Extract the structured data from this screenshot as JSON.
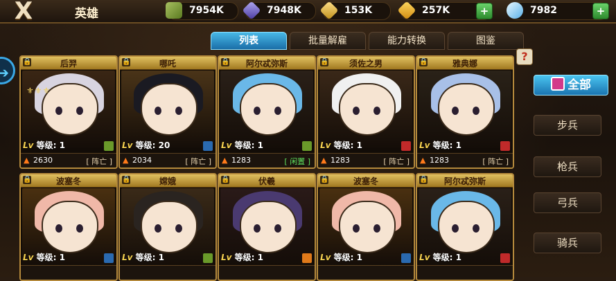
{
  "header": {
    "close_label": "X",
    "title": "英雄",
    "resources": [
      {
        "name": "wood",
        "value": "7954K",
        "icon": "wood-icon",
        "color": "#7a9a3a"
      },
      {
        "name": "stone",
        "value": "7948K",
        "icon": "crystal-icon",
        "color": "#6a5ac0"
      },
      {
        "name": "gold-ore",
        "value": "153K",
        "icon": "gold-ore-icon",
        "color": "#e0b83a"
      },
      {
        "name": "gold",
        "value": "257K",
        "icon": "gold-icon",
        "color": "#f0b820"
      },
      {
        "name": "diamond",
        "value": "7982",
        "icon": "diamond-icon",
        "color": "#9ad8ff"
      }
    ]
  },
  "tabs": [
    {
      "label": "列表",
      "active": true
    },
    {
      "label": "批量解雇",
      "active": false
    },
    {
      "label": "能力转换",
      "active": false
    },
    {
      "label": "图鉴",
      "active": false
    }
  ],
  "help_label": "?",
  "heroes": [
    {
      "name": "后羿",
      "level": "1",
      "power": "2630",
      "status": "阵亡",
      "hair": "#d8d4e0",
      "bg": "#3a2614",
      "badge": "#6a9a2a",
      "stars": "⚜⚜⚜"
    },
    {
      "name": "哪吒",
      "level": "20",
      "power": "2034",
      "status": "阵亡",
      "hair": "#1a1a22",
      "bg": "#4a3418",
      "badge": "#2a6ab0",
      "stars": ""
    },
    {
      "name": "阿尔忒弥斯",
      "level": "1",
      "power": "1283",
      "status": "闲置",
      "hair": "#6ab8e8",
      "bg": "#2a2018",
      "badge": "#6a9a2a",
      "stars": ""
    },
    {
      "name": "须佐之男",
      "level": "1",
      "power": "1283",
      "status": "阵亡",
      "hair": "#f0f0f0",
      "bg": "#3a2818",
      "badge": "#c02a2a",
      "stars": ""
    },
    {
      "name": "雅典娜",
      "level": "1",
      "power": "1283",
      "status": "阵亡",
      "hair": "#a8c0e8",
      "bg": "#2a2218",
      "badge": "#c02a2a",
      "stars": ""
    },
    {
      "name": "波塞冬",
      "level": "1",
      "power": "",
      "status": "",
      "hair": "#f0b8a8",
      "bg": "#4a3010",
      "badge": "#2a6ab0",
      "stars": ""
    },
    {
      "name": "嫦娥",
      "level": "1",
      "power": "",
      "status": "",
      "hair": "#2a2420",
      "bg": "#3a2a18",
      "badge": "#6a9a2a",
      "stars": ""
    },
    {
      "name": "伏羲",
      "level": "1",
      "power": "",
      "status": "",
      "hair": "#4a3a70",
      "bg": "#2a1a18",
      "badge": "#e07a1a",
      "stars": ""
    },
    {
      "name": "波塞冬",
      "level": "1",
      "power": "",
      "status": "",
      "hair": "#f0b8a8",
      "bg": "#4a3010",
      "badge": "#2a6ab0",
      "stars": ""
    },
    {
      "name": "阿尔忒弥斯",
      "level": "1",
      "power": "",
      "status": "",
      "hair": "#6ab8e8",
      "bg": "#2a2018",
      "badge": "#c02a2a",
      "stars": ""
    }
  ],
  "labels": {
    "level_prefix": "Lv",
    "level_text": "等级:"
  },
  "filters": [
    {
      "label": "全部",
      "active": true
    },
    {
      "label": "步兵",
      "active": false
    },
    {
      "label": "枪兵",
      "active": false
    },
    {
      "label": "弓兵",
      "active": false
    },
    {
      "label": "骑兵",
      "active": false
    }
  ]
}
